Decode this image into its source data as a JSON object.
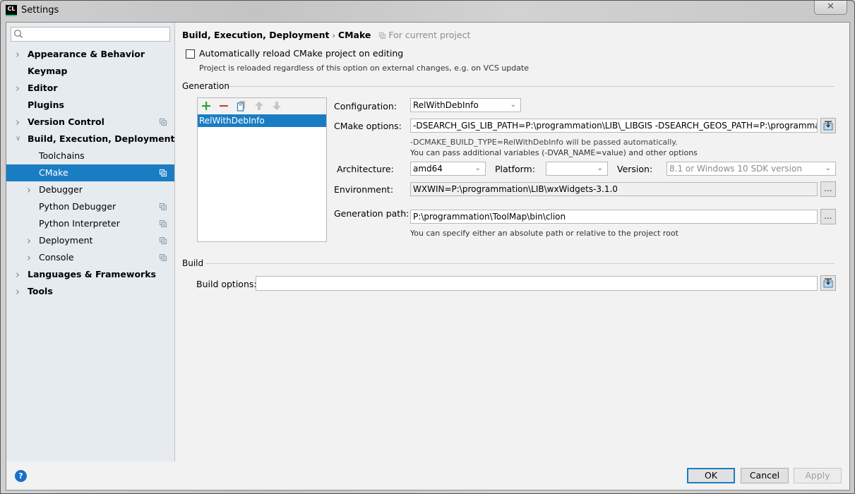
{
  "window": {
    "title": "Settings",
    "app_icon_text": "CL",
    "close_glyph": "✕"
  },
  "sidebar": {
    "search": {
      "placeholder": "",
      "value": ""
    },
    "items": [
      {
        "label": "Appearance & Behavior",
        "level": 0,
        "expandable": true,
        "expanded": false,
        "bold": true,
        "project_scoped": false,
        "selected": false
      },
      {
        "label": "Keymap",
        "level": 0,
        "expandable": false,
        "bold": true,
        "project_scoped": false,
        "selected": false
      },
      {
        "label": "Editor",
        "level": 0,
        "expandable": true,
        "expanded": false,
        "bold": true,
        "project_scoped": false,
        "selected": false
      },
      {
        "label": "Plugins",
        "level": 0,
        "expandable": false,
        "bold": true,
        "project_scoped": false,
        "selected": false
      },
      {
        "label": "Version Control",
        "level": 0,
        "expandable": true,
        "expanded": false,
        "bold": true,
        "project_scoped": true,
        "selected": false
      },
      {
        "label": "Build, Execution, Deployment",
        "level": 0,
        "expandable": true,
        "expanded": true,
        "bold": true,
        "project_scoped": false,
        "selected": false
      },
      {
        "label": "Toolchains",
        "level": 1,
        "expandable": false,
        "bold": false,
        "project_scoped": false,
        "selected": false
      },
      {
        "label": "CMake",
        "level": 1,
        "expandable": false,
        "bold": false,
        "project_scoped": true,
        "selected": true
      },
      {
        "label": "Debugger",
        "level": 1,
        "expandable": true,
        "expanded": false,
        "bold": false,
        "project_scoped": false,
        "selected": false
      },
      {
        "label": "Python Debugger",
        "level": 1,
        "expandable": false,
        "bold": false,
        "project_scoped": true,
        "selected": false
      },
      {
        "label": "Python Interpreter",
        "level": 1,
        "expandable": false,
        "bold": false,
        "project_scoped": true,
        "selected": false
      },
      {
        "label": "Deployment",
        "level": 1,
        "expandable": true,
        "expanded": false,
        "bold": false,
        "project_scoped": true,
        "selected": false
      },
      {
        "label": "Console",
        "level": 1,
        "expandable": true,
        "expanded": false,
        "bold": false,
        "project_scoped": true,
        "selected": false
      },
      {
        "label": "Languages & Frameworks",
        "level": 0,
        "expandable": true,
        "expanded": false,
        "bold": true,
        "project_scoped": false,
        "selected": false
      },
      {
        "label": "Tools",
        "level": 0,
        "expandable": true,
        "expanded": false,
        "bold": true,
        "project_scoped": false,
        "selected": false
      }
    ]
  },
  "main": {
    "breadcrumb": {
      "parent": "Build, Execution, Deployment",
      "separator": "›",
      "current": "CMake",
      "scope_note": "For current project"
    },
    "auto_reload": {
      "label": "Automatically reload CMake project on editing",
      "checked": false,
      "hint": "Project is reloaded regardless of this option on external changes, e.g. on VCS update"
    },
    "generation": {
      "title": "Generation",
      "toolbar": [
        "add",
        "remove",
        "copy",
        "move-up",
        "move-down"
      ],
      "profiles": [
        "RelWithDebInfo"
      ],
      "selected_profile": "RelWithDebInfo",
      "configuration_label": "Configuration:",
      "configuration_value": "RelWithDebInfo",
      "cmake_options_label": "CMake options:",
      "cmake_options_value": "-DSEARCH_GIS_LIB_PATH=P:\\programmation\\LIB\\_LIBGIS -DSEARCH_GEOS_PATH=P:\\programmation\\LIB\\",
      "cmake_hint_1": "-DCMAKE_BUILD_TYPE=RelWithDebInfo will be passed automatically.",
      "cmake_hint_2": "You can pass additional variables (-DVAR_NAME=value) and other options",
      "architecture_label": "Architecture:",
      "architecture_value": "amd64",
      "platform_label": "Platform:",
      "platform_value": "",
      "version_label": "Version:",
      "version_placeholder": "8.1 or Windows 10 SDK version",
      "environment_label": "Environment:",
      "environment_value": "WXWIN=P:\\programmation\\LIB\\wxWidgets-3.1.0",
      "generation_path_label": "Generation path:",
      "generation_path_value": "P:\\programmation\\ToolMap\\bin\\clion",
      "generation_path_hint": "You can specify either an absolute path or relative to the project root",
      "browse_label": "..."
    },
    "build": {
      "title": "Build",
      "build_options_label": "Build options:",
      "build_options_value": ""
    }
  },
  "footer": {
    "help_glyph": "?",
    "ok_label": "OK",
    "cancel_label": "Cancel",
    "apply_label": "Apply",
    "apply_enabled": false
  },
  "colors": {
    "selection": "#1a7dc4",
    "sidebar_bg": "#e6ebf0",
    "panel_bg": "#f2f2f2",
    "add_icon": "#2e9e3a",
    "remove_icon": "#c7443c",
    "help_icon": "#1b6fc8"
  }
}
